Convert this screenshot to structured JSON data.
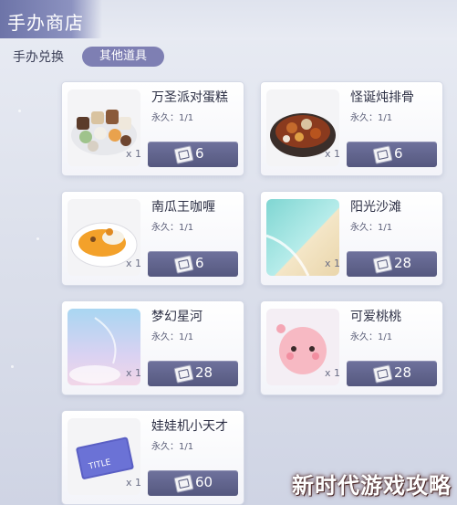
{
  "header": {
    "title": "手办商店"
  },
  "tabs": {
    "exchange_label": "手办兑换",
    "other_label": "其他道具"
  },
  "items": [
    {
      "name": "万圣派对蛋糕",
      "permanence": "永久：1/1",
      "qty": "x 1",
      "price": "6"
    },
    {
      "name": "怪诞炖排骨",
      "permanence": "永久：1/1",
      "qty": "x 1",
      "price": "6"
    },
    {
      "name": "南瓜王咖喱",
      "permanence": "永久：1/1",
      "qty": "x 1",
      "price": "6"
    },
    {
      "name": "阳光沙滩",
      "permanence": "永久：1/1",
      "qty": "x 1",
      "price": "28"
    },
    {
      "name": "梦幻星河",
      "permanence": "永久：1/1",
      "qty": "x 1",
      "price": "28"
    },
    {
      "name": "可爱桃桃",
      "permanence": "永久：1/1",
      "qty": "x 1",
      "price": "28"
    },
    {
      "name": "娃娃机小天才",
      "permanence": "永久：1/1",
      "qty": "x 1",
      "price": "60"
    }
  ],
  "watermark": "新时代游戏攻略",
  "card_image_text": "TITLE",
  "icons": {
    "currency": "ticket-icon"
  },
  "colors": {
    "accent": "#7e7fb3",
    "button": "#5f628b"
  }
}
